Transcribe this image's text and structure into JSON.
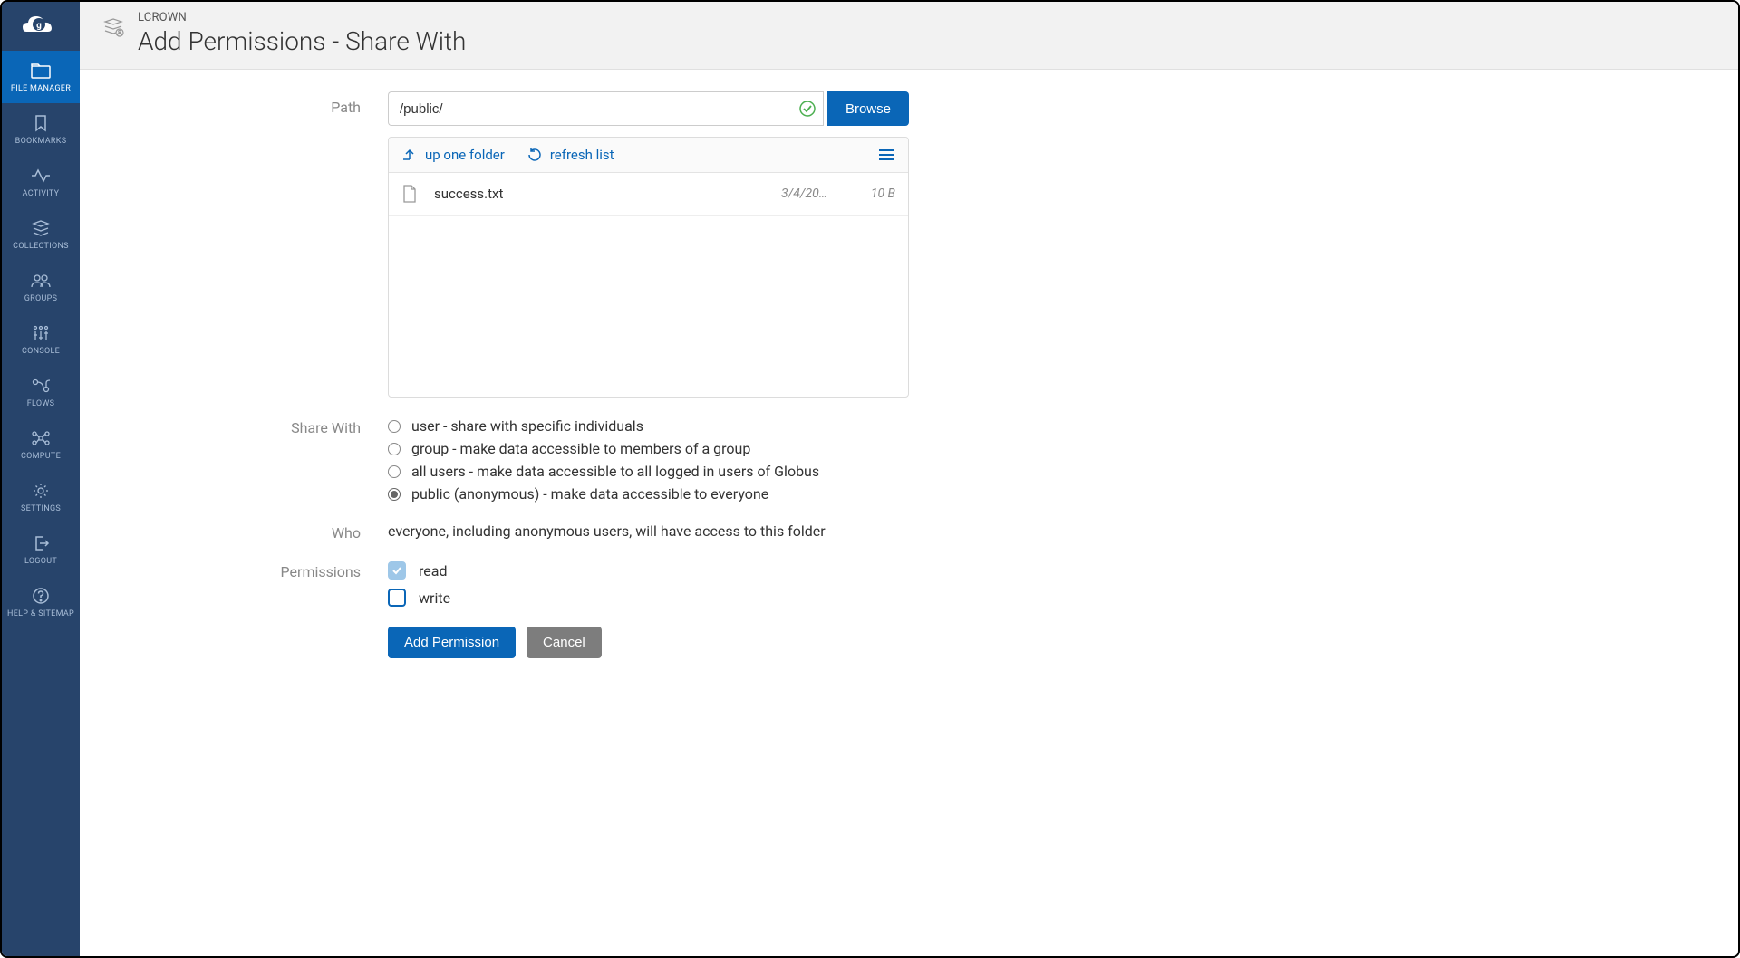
{
  "sidebar": {
    "items": [
      {
        "label": "FILE MANAGER",
        "icon": "folder",
        "active": true
      },
      {
        "label": "BOOKMARKS",
        "icon": "bookmark",
        "active": false
      },
      {
        "label": "ACTIVITY",
        "icon": "activity",
        "active": false
      },
      {
        "label": "COLLECTIONS",
        "icon": "stack",
        "active": false
      },
      {
        "label": "GROUPS",
        "icon": "groups",
        "active": false
      },
      {
        "label": "CONSOLE",
        "icon": "console",
        "active": false
      },
      {
        "label": "FLOWS",
        "icon": "flows",
        "active": false
      },
      {
        "label": "COMPUTE",
        "icon": "compute",
        "active": false
      },
      {
        "label": "SETTINGS",
        "icon": "gear",
        "active": false
      },
      {
        "label": "LOGOUT",
        "icon": "logout",
        "active": false
      },
      {
        "label": "HELP & SITEMAP",
        "icon": "help",
        "active": false
      }
    ]
  },
  "header": {
    "breadcrumb": "LCROWN",
    "title": "Add Permissions - Share With"
  },
  "form": {
    "path_label": "Path",
    "path_value": "/public/",
    "browse_label": "Browse",
    "up_one_folder": "up one folder",
    "refresh_list": "refresh list",
    "files": [
      {
        "name": "success.txt",
        "date": "3/4/20…",
        "size": "10 B"
      }
    ],
    "share_with_label": "Share With",
    "share_options": [
      {
        "key": "user",
        "label": "user - share with specific individuals",
        "selected": false
      },
      {
        "key": "group",
        "label": "group - make data accessible to members of a group",
        "selected": false
      },
      {
        "key": "allusers",
        "label": "all users - make data accessible to all logged in users of Globus",
        "selected": false
      },
      {
        "key": "public",
        "label": "public (anonymous) - make data accessible to everyone",
        "selected": true
      }
    ],
    "who_label": "Who",
    "who_text": "everyone, including anonymous users, will have access to this folder",
    "permissions_label": "Permissions",
    "perm_read": "read",
    "perm_write": "write",
    "add_permission_btn": "Add Permission",
    "cancel_btn": "Cancel"
  }
}
